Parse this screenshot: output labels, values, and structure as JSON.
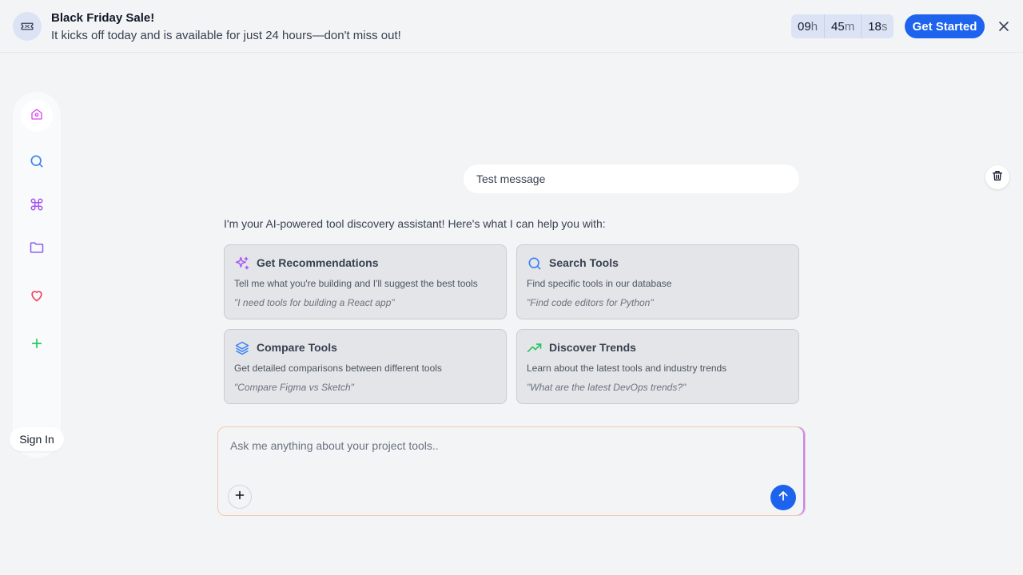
{
  "banner": {
    "title": "Black Friday Sale!",
    "subtitle": "It kicks off today and is available for just 24 hours—don't miss out!",
    "countdown": [
      {
        "value": "09",
        "suffix": "h"
      },
      {
        "value": "45",
        "suffix": "m"
      },
      {
        "value": "18",
        "suffix": "s"
      }
    ],
    "cta_label": "Get Started",
    "close_icon": "close-icon",
    "icon": "ticket-icon"
  },
  "sidebar": {
    "items": [
      {
        "icon": "home-icon",
        "color": "#d946ef",
        "active": true
      },
      {
        "icon": "search-icon",
        "color": "#3b82f6"
      },
      {
        "icon": "command-icon",
        "color": "#a855f7"
      },
      {
        "icon": "folder-icon",
        "color": "#8b5cf6"
      },
      {
        "icon": "heart-icon",
        "color": "#f43f5e"
      },
      {
        "icon": "plus-icon",
        "color": "#22c55e"
      }
    ],
    "sign_in_label": "Sign In"
  },
  "chat": {
    "user_message": "Test message",
    "intro": "I'm your AI-powered tool discovery assistant! Here's what I can help you with:",
    "cards": [
      {
        "icon": "sparkles-icon",
        "color": "#a855f7",
        "title": "Get Recommendations",
        "description": "Tell me what you're building and I'll suggest the best tools",
        "example": "\"I need tools for building a React app\""
      },
      {
        "icon": "search-icon",
        "color": "#3b82f6",
        "title": "Search Tools",
        "description": "Find specific tools in our database",
        "example": "\"Find code editors for Python\""
      },
      {
        "icon": "layers-icon",
        "color": "#3b82f6",
        "title": "Compare Tools",
        "description": "Get detailed comparisons between different tools",
        "example": "\"Compare Figma vs Sketch\""
      },
      {
        "icon": "trending-up-icon",
        "color": "#22c55e",
        "title": "Discover Trends",
        "description": "Learn about the latest tools and industry trends",
        "example": "\"What are the latest DevOps trends?\""
      }
    ]
  },
  "composer": {
    "placeholder": "Ask me anything about your project tools..",
    "value": ""
  },
  "colors": {
    "accent": "#1d63ed",
    "background": "#f3f4f6"
  }
}
